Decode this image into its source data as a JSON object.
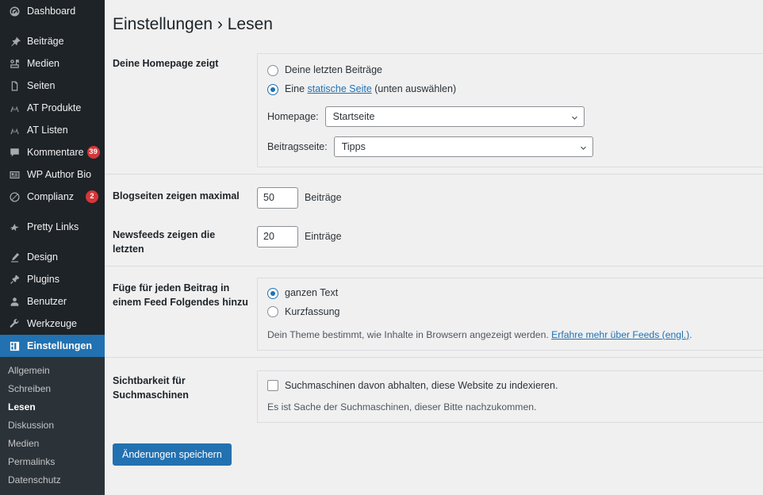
{
  "sidebar": {
    "items": [
      {
        "label": "Dashboard",
        "icon": "dashboard-icon",
        "badge": null,
        "gap_after": true
      },
      {
        "label": "Beiträge",
        "icon": "pin-icon",
        "badge": null
      },
      {
        "label": "Medien",
        "icon": "media-icon",
        "badge": null
      },
      {
        "label": "Seiten",
        "icon": "pages-icon",
        "badge": null
      },
      {
        "label": "AT Produkte",
        "icon": "at-products-icon",
        "badge": null
      },
      {
        "label": "AT Listen",
        "icon": "at-lists-icon",
        "badge": null
      },
      {
        "label": "Kommentare",
        "icon": "comments-icon",
        "badge": "39"
      },
      {
        "label": "WP Author Bio",
        "icon": "author-bio-icon",
        "badge": null
      },
      {
        "label": "Complianz",
        "icon": "complianz-icon",
        "badge": "2",
        "gap_after": true
      },
      {
        "label": "Pretty Links",
        "icon": "pretty-links-icon",
        "badge": null,
        "gap_after": true
      },
      {
        "label": "Design",
        "icon": "appearance-icon",
        "badge": null
      },
      {
        "label": "Plugins",
        "icon": "plugins-icon",
        "badge": null
      },
      {
        "label": "Benutzer",
        "icon": "users-icon",
        "badge": null
      },
      {
        "label": "Werkzeuge",
        "icon": "tools-icon",
        "badge": null
      },
      {
        "label": "Einstellungen",
        "icon": "settings-icon",
        "badge": null,
        "active": true
      }
    ],
    "submenu": [
      {
        "label": "Allgemein",
        "current": false
      },
      {
        "label": "Schreiben",
        "current": false
      },
      {
        "label": "Lesen",
        "current": true
      },
      {
        "label": "Diskussion",
        "current": false
      },
      {
        "label": "Medien",
        "current": false
      },
      {
        "label": "Permalinks",
        "current": false
      },
      {
        "label": "Datenschutz",
        "current": false
      }
    ]
  },
  "page": {
    "title": "Einstellungen › Lesen"
  },
  "homepage_section": {
    "label": "Deine Homepage zeigt",
    "option_latest_posts": "Deine letzten Beiträge",
    "option_static_prefix": "Eine ",
    "option_static_link": "statische Seite",
    "option_static_suffix": " (unten auswählen)",
    "selected": "static_page",
    "homepage_label": "Homepage:",
    "homepage_value": "Startseite",
    "posts_page_label": "Beitragsseite:",
    "posts_page_value": "Tipps"
  },
  "posts_per_page": {
    "label": "Blogseiten zeigen maximal",
    "value": "50",
    "suffix": "Beiträge"
  },
  "posts_per_rss": {
    "label": "Newsfeeds zeigen die letzten",
    "value": "20",
    "suffix": "Einträge"
  },
  "feed_section": {
    "label": "Füge für jeden Beitrag in einem Feed Folgendes hinzu",
    "option_full": "ganzen Text",
    "option_summary": "Kurzfassung",
    "selected": "full",
    "help_prefix": "Dein Theme bestimmt, wie Inhalte in Browsern angezeigt werden. ",
    "help_link": "Erfahre mehr über Feeds (engl.)",
    "help_suffix": "."
  },
  "visibility_section": {
    "label": "Sichtbarkeit für Suchmaschinen",
    "checkbox_label": "Suchmaschinen davon abhalten, diese Website zu indexieren.",
    "checked": false,
    "help_text": "Es ist Sache der Suchmaschinen, dieser Bitte nachzukommen."
  },
  "submit": {
    "label": "Änderungen speichern"
  },
  "colors": {
    "sidebar_bg": "#1d2327",
    "submenu_bg": "#2c3338",
    "accent": "#2271b1",
    "badge": "#d63638",
    "content_bg": "#f0f0f1",
    "border": "#dcdcde"
  }
}
